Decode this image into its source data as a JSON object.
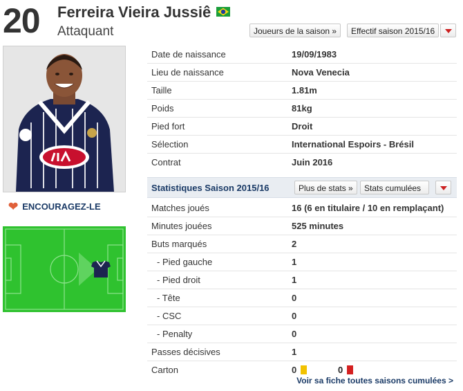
{
  "player": {
    "number": "20",
    "name": "Ferreira Vieira Jussiê",
    "position": "Attaquant"
  },
  "buttons": {
    "season_players": "Joueurs de la saison »",
    "squad": "Effectif saison 2015/16",
    "more_stats": "Plus de stats »",
    "cumulative": "Stats cumulées"
  },
  "encourage": "ENCOURAGEZ-LE",
  "info": [
    {
      "label": "Date de naissance",
      "value": "19/09/1983"
    },
    {
      "label": "Lieu de naissance",
      "value": "Nova Venecia"
    },
    {
      "label": "Taille",
      "value": "1.81m"
    },
    {
      "label": "Poids",
      "value": "81kg"
    },
    {
      "label": "Pied fort",
      "value": "Droit"
    },
    {
      "label": "Sélection",
      "value": "International Espoirs - Brésil"
    },
    {
      "label": "Contrat",
      "value": "Juin 2016"
    }
  ],
  "stats_title": "Statistiques Saison 2015/16",
  "stats": [
    {
      "label": "Matches joués",
      "value": "16 (6 en titulaire / 10 en remplaçant)"
    },
    {
      "label": "Minutes jouées",
      "value": "525 minutes"
    },
    {
      "label": "Buts marqués",
      "value": "2"
    },
    {
      "label": "- Pied gauche",
      "value": "1"
    },
    {
      "label": "- Pied droit",
      "value": "1"
    },
    {
      "label": "- Tête",
      "value": "0"
    },
    {
      "label": "- CSC",
      "value": "0"
    },
    {
      "label": "- Penalty",
      "value": "0"
    },
    {
      "label": "Passes décisives",
      "value": "1"
    }
  ],
  "carton": {
    "label": "Carton",
    "yellow": "0",
    "red": "0"
  },
  "footer_link": "Voir sa fiche toutes saisons cumulées >",
  "colors": {
    "accent": "#1a3a66",
    "alert": "#cc2020",
    "yellow_card": "#f2c200",
    "red_card": "#d42020",
    "pitch": "#2fc22f"
  },
  "icons": {
    "flag": "brazil-flag-icon",
    "heart": "heart-icon",
    "caret": "caret-down-icon",
    "shirt": "jersey-icon"
  }
}
